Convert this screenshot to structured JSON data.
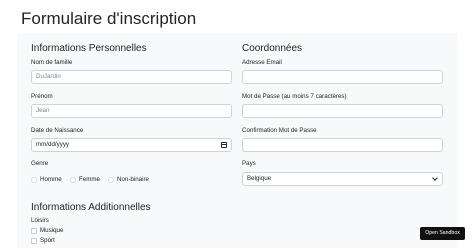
{
  "page": {
    "title": "Formulaire d'inscription"
  },
  "personal": {
    "title": "Informations Personnelles",
    "last_name": {
      "label": "Nom de famille",
      "placeholder": "DuJardin"
    },
    "first_name": {
      "label": "Prénom",
      "placeholder": "Jean"
    },
    "birth_date": {
      "label": "Date de Naissance",
      "placeholder": "mm/dd/yyyy"
    },
    "gender": {
      "label": "Genre",
      "options": [
        "Homme",
        "Femme",
        "Non-binaire"
      ]
    }
  },
  "contact": {
    "title": "Coordonnées",
    "email": {
      "label": "Adresse Email",
      "value": ""
    },
    "password": {
      "label": "Mot de Passe (au moins 7 caractères)",
      "value": ""
    },
    "password_confirm": {
      "label": "Confirmation Mot de Passe",
      "value": ""
    },
    "country": {
      "label": "Pays",
      "value": "Belgique"
    }
  },
  "additional": {
    "title": "Informations Additionnelles",
    "hobbies": {
      "label": "Loisirs",
      "options": [
        "Musique",
        "Sport"
      ]
    }
  },
  "sandbox": {
    "label": "Open Sandbox"
  },
  "colors": {
    "card_bg": "#f8f9fa",
    "text": "#212529",
    "border": "#ced4da",
    "button_bg": "#111111"
  }
}
